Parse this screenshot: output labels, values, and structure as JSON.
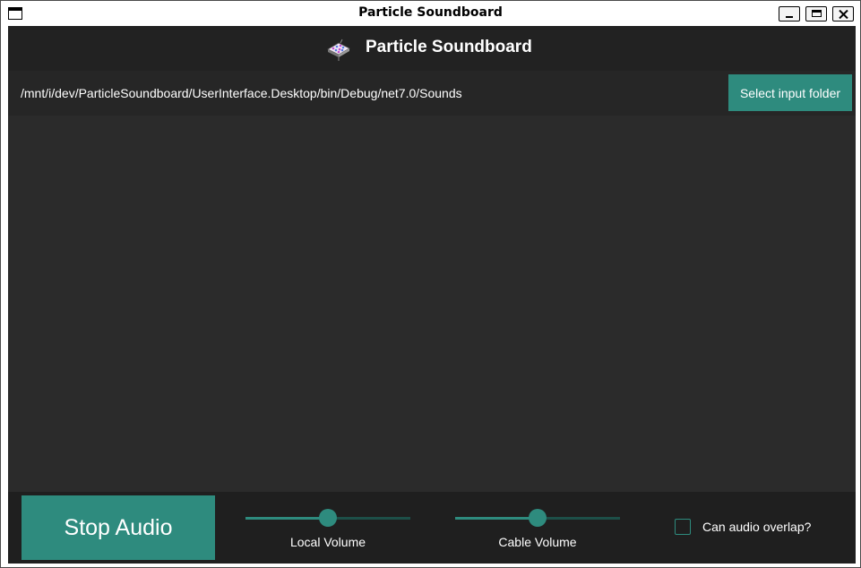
{
  "window": {
    "title": "Particle Soundboard"
  },
  "header": {
    "title": "Particle Soundboard",
    "logo_icon": "soundboard-logo-icon"
  },
  "pathbar": {
    "path": "/mnt/i/dev/ParticleSoundboard/UserInterface.Desktop/bin/Debug/net7.0/Sounds",
    "select_button_label": "Select input folder"
  },
  "footer": {
    "stop_button_label": "Stop Audio",
    "local_volume": {
      "label": "Local Volume",
      "value": 0.5
    },
    "cable_volume": {
      "label": "Cable Volume",
      "value": 0.5
    },
    "overlap": {
      "label": "Can audio overlap?",
      "checked": false
    }
  },
  "colors": {
    "accent": "#2e8b7e",
    "background": "#2b2b2b",
    "header": "#222222"
  }
}
